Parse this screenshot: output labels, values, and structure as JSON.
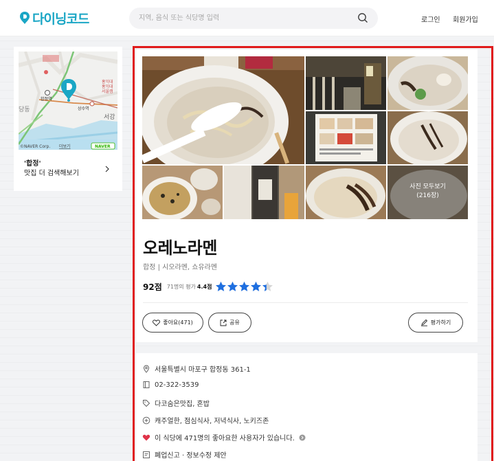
{
  "header": {
    "logo_text": "다이닝코드",
    "search_placeholder": "지역, 음식 또는 식당명 입력",
    "login": "로그인",
    "signup": "회원가입"
  },
  "map_card": {
    "map_labels": {
      "hapjeong": "합정역",
      "sangsu": "상수역",
      "seogang": "서강",
      "dang": "당동",
      "hongik_1": "홍익대",
      "hongik_2": "홍익대",
      "hongik_3": "서울캠",
      "credit": "©NAVER Corp.",
      "more": "더보기",
      "naver": "NAVER"
    },
    "search_query": "'합정'",
    "search_label": "맛집 더 검색해보기"
  },
  "restaurant": {
    "name": "오레노라멘",
    "meta": "합정 | 시오라멘, 쇼유라멘",
    "score": "92점",
    "rating_count": "71명의 평가",
    "rating_avg": "4.4점",
    "rating_value": 4.4,
    "star_color": "#1f6fe0",
    "photos_all_label": "사진 모두보기",
    "photos_count": "(216장)",
    "like_button": "좋아요(471)",
    "share_button": "공유",
    "review_button": "평가하기"
  },
  "details": {
    "address": "서울특별시 마포구 합정동 361-1",
    "phone": "02-322-3539",
    "tags": "다코숨은맛집, 혼밥",
    "features": "캐주얼한, 점심식사, 저녁식사, 노키즈존",
    "likes_text": "이 식당에 471명의 좋아요한 사용자가 있습니다.",
    "report": "폐업신고 · 정보수정 제안"
  },
  "colors": {
    "accent": "#1aa6c5",
    "highlight_border": "#e01a1a",
    "heart": "#e0344a"
  }
}
